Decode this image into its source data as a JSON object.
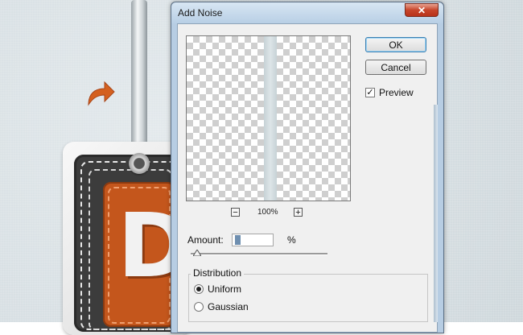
{
  "dialog": {
    "title": "Add Noise",
    "close_glyph": "✕",
    "ok_label": "OK",
    "cancel_label": "Cancel",
    "preview": {
      "label": "Preview",
      "checked": true,
      "check_glyph": "✓"
    },
    "zoom": {
      "minus": "−",
      "plus": "+",
      "level": "100%"
    },
    "amount": {
      "label": "Amount:",
      "value": "",
      "unit": "%"
    },
    "distribution": {
      "legend": "Distribution",
      "options": [
        {
          "label": "Uniform",
          "selected": true
        },
        {
          "label": "Gaussian",
          "selected": false
        }
      ]
    }
  },
  "background": {
    "letter": "D",
    "icons": [
      "redo-arrow-icon"
    ],
    "colors": {
      "accent": "#c4561c",
      "leather": "#3c3c3c",
      "canvas": "#d7dfe3"
    }
  }
}
